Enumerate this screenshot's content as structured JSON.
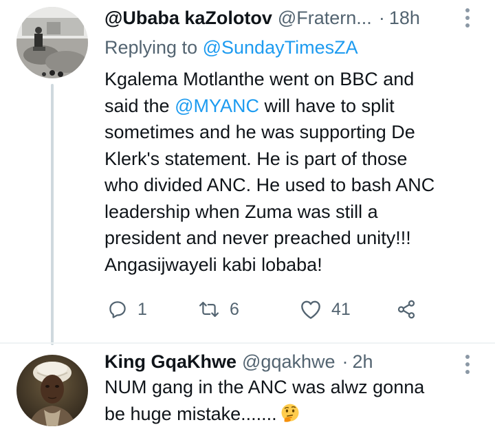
{
  "tweets": [
    {
      "display_name": "@Ubaba kaZolotov",
      "handle": "@Fratern...",
      "separator": "·",
      "time": "18h",
      "replying_label": "Replying to",
      "replying_to": "@SundayTimesZA",
      "text_lines": [
        "Kgalema Motlanthe went on BBC and",
        [
          "said the ",
          "@MYANC",
          " will have to split"
        ],
        "sometimes and he was supporting De",
        "Klerk's statement. He is part of those",
        "who divided ANC. He used to bash ANC",
        "leadership when Zuma was still a",
        "president and never preached unity!!!",
        "Angasijwayeli kabi lobaba!"
      ],
      "reply_count": "1",
      "retweet_count": "6",
      "like_count": "41"
    },
    {
      "display_name": "King GqaKhwe",
      "handle": "@gqakhwe",
      "separator": "·",
      "time": "2h",
      "text_lines": [
        "NUM gang in the ANC was alwz gonna",
        "be huge mistake......."
      ],
      "emoji": "thinking-face"
    }
  ],
  "icons": [
    "more-icon",
    "reply-icon",
    "retweet-icon",
    "like-icon",
    "share-icon",
    "thinking-face-emoji"
  ],
  "colors": {
    "text": "#0f1419",
    "secondary": "#536471",
    "link": "#1d9bf0",
    "line": "#cfd9de"
  }
}
